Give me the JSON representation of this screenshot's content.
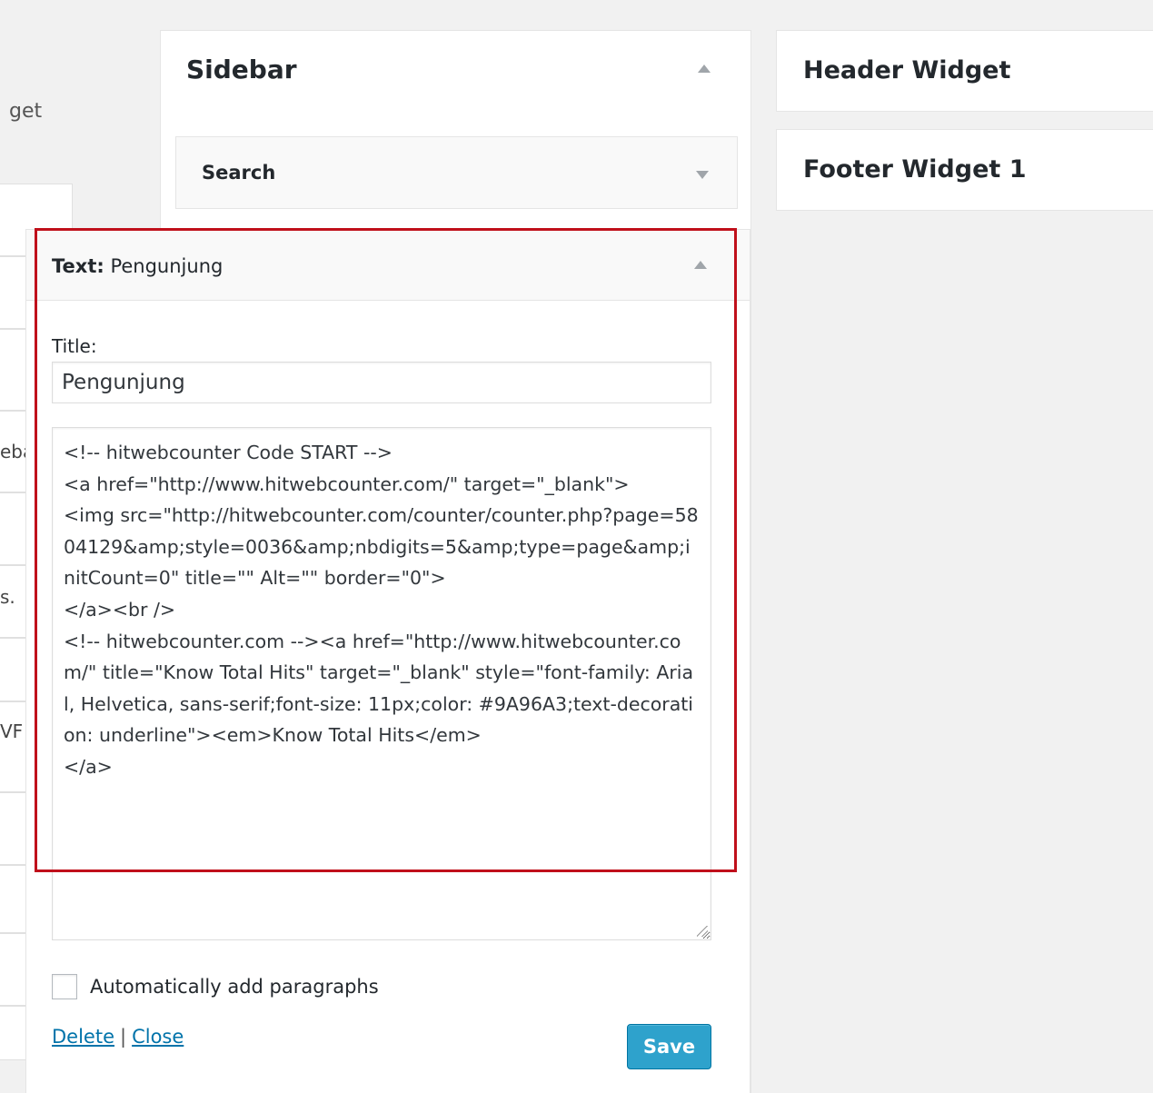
{
  "left_panel": {
    "label_fragment": "get",
    "fragments": [
      "eba",
      "s.",
      "VF"
    ]
  },
  "sidebar": {
    "title": "Sidebar",
    "widgets": [
      {
        "title": "Search"
      }
    ]
  },
  "text_widget": {
    "type_label": "Text:",
    "name": "Pengunjung",
    "title_label": "Title:",
    "title_value": "Pengunjung",
    "content": "<!-- hitwebcounter Code START -->\n<a href=\"http://www.hitwebcounter.com/\" target=\"_blank\">\n<img src=\"http://hitwebcounter.com/counter/counter.php?page=5804129&amp;style=0036&amp;nbdigits=5&amp;type=page&amp;initCount=0\" title=\"\" Alt=\"\" border=\"0\">\n</a><br />\n<!-- hitwebcounter.com --><a href=\"http://www.hitwebcounter.com/\" title=\"Know Total Hits\" target=\"_blank\" style=\"font-family: Arial, Helvetica, sans-serif;font-size: 11px;color: #9A96A3;text-decoration: underline\"><em>Know Total Hits</em>\n</a>",
    "auto_paragraph_label": "Automatically add paragraphs",
    "auto_paragraph_checked": false,
    "delete_label": "Delete",
    "separator": "|",
    "close_label": "Close",
    "save_label": "Save"
  },
  "right_column": {
    "areas": [
      {
        "title": "Header Widget"
      },
      {
        "title": "Footer Widget 1"
      }
    ]
  },
  "colors": {
    "highlight": "#c0101b",
    "primary_button": "#2ea2cc",
    "link": "#0073aa",
    "background": "#f1f1f1"
  }
}
